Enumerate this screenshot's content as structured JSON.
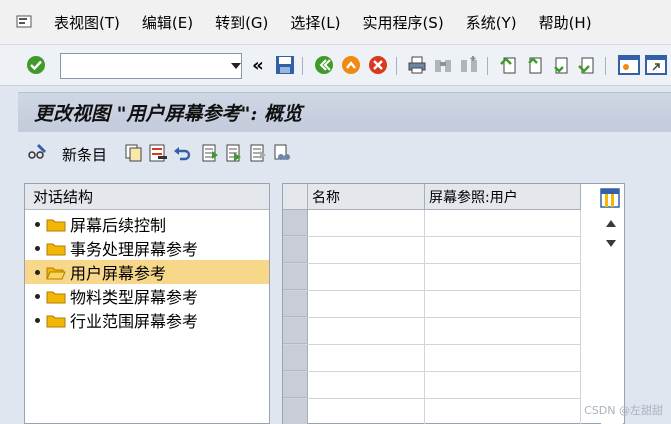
{
  "menubar": {
    "items": [
      "表视图(T)",
      "编辑(E)",
      "转到(G)",
      "选择(L)",
      "实用程序(S)",
      "系统(Y)",
      "帮助(H)"
    ]
  },
  "toolbar": {
    "command_value": "",
    "back_glyph": "«",
    "icons": [
      "check-icon",
      "save-icon",
      "back-icon",
      "exit-icon",
      "cancel-icon",
      "print-icon",
      "find-icon",
      "find-next-icon",
      "first-page-icon",
      "prev-page-icon",
      "next-page-icon",
      "last-page-icon",
      "new-session-icon",
      "shortcut-icon"
    ]
  },
  "title": "更改视图 \"用户屏幕参考\": 概览",
  "app_toolbar": {
    "new_entries": "新条目"
  },
  "dialog": {
    "header": "对话结构",
    "items": [
      {
        "label": "屏幕后续控制",
        "open": false,
        "selected": false
      },
      {
        "label": "事务处理屏幕参考",
        "open": false,
        "selected": false
      },
      {
        "label": "用户屏幕参考",
        "open": true,
        "selected": true
      },
      {
        "label": "物料类型屏幕参考",
        "open": false,
        "selected": false
      },
      {
        "label": "行业范围屏幕参考",
        "open": false,
        "selected": false
      }
    ]
  },
  "table": {
    "columns": [
      "名称",
      "屏幕参照:用户"
    ],
    "row_count": 8
  },
  "watermark": "CSDN @左甜甜",
  "colors": {
    "title_bg": "#c3cbdc",
    "selected_row": "#f7d88a",
    "folder": "#f2b705",
    "green": "#3f9a2a",
    "orange": "#ef8a12",
    "red": "#d93a1e"
  }
}
